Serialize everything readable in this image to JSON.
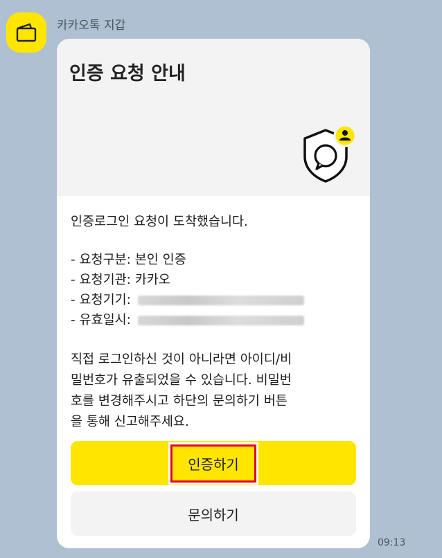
{
  "chat": {
    "sender_name": "카카오톡 지갑",
    "timestamp": "09:13"
  },
  "message": {
    "title": "인증 요청 안내",
    "intro": "인증로그인 요청이 도착했습니다.",
    "details": [
      {
        "label": "- 요청구분:",
        "value": "본인 인증"
      },
      {
        "label": "- 요청기관:",
        "value": "카카오"
      },
      {
        "label": "- 요청기기:",
        "value": ""
      },
      {
        "label": "- 유효일시:",
        "value": ""
      }
    ],
    "warning_lines": [
      "직접 로그인하신 것이 아니라면 아이디/비",
      "밀번호가 유출되었을 수 있습니다. 비밀번",
      "호를 변경해주시고 하단의 문의하기 버튼",
      "을 통해 신고해주세요."
    ],
    "primary_button": "인증하기",
    "secondary_button": "문의하기"
  },
  "colors": {
    "background": "#aec0d1",
    "brand_yellow": "#ffe600",
    "highlight_red": "#e5002b"
  },
  "icons": [
    "wallet-icon",
    "shield-chat-icon",
    "user-badge-icon"
  ]
}
